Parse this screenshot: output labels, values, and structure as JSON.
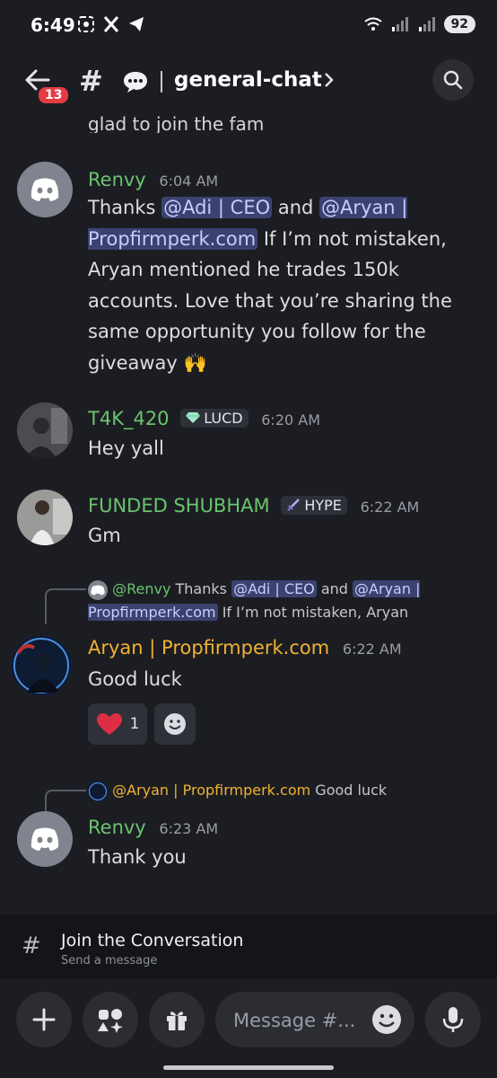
{
  "status": {
    "time": "6:49",
    "battery": "92"
  },
  "header": {
    "unread_count": "13",
    "channel_name": "general-chat"
  },
  "clipped_text": "glad to join the fam",
  "messages": [
    {
      "author": "Renvy",
      "time": "6:04 AM",
      "author_color": "#69c46e",
      "text_parts": {
        "a": "Thanks ",
        "m1": "@Adi | CEO",
        "b": " and ",
        "m2": "@Aryan | Propfirmperk.com",
        "c": "  If I’m not mistaken, Aryan mentioned he trades 150k accounts. Love that you’re sharing the same opportunity you follow for the giveaway 🙌"
      }
    },
    {
      "author": "T4K_420",
      "role_badge": "LUCD",
      "time": "6:20 AM",
      "author_color": "#69c46e",
      "text": "Hey yall"
    },
    {
      "author": "FUNDED SHUBHAM",
      "role_badge": "HYPE",
      "time": "6:22 AM",
      "author_color": "#69c46e",
      "text": "Gm"
    },
    {
      "reply": {
        "author": "@Renvy",
        "a": "Thanks ",
        "m1": "@Adi | CEO",
        "b": " and ",
        "m2": "@Aryan | Propfirmperk.com",
        "c": "  If I’m not mistaken, Aryan"
      },
      "author": "Aryan | Propfirmperk.com",
      "time": "6:22 AM",
      "author_color": "#f0b232",
      "text": "Good luck",
      "reactions": [
        {
          "emoji": "heart",
          "count": "1"
        },
        {
          "emoji": "add-reaction",
          "count": ""
        }
      ]
    },
    {
      "reply": {
        "author": "@Aryan | Propfirmperk.com",
        "text": "Good luck"
      },
      "author": "Renvy",
      "time": "6:23 AM",
      "author_color": "#69c46e",
      "text": "Thank you"
    }
  ],
  "join_banner": {
    "title": "Join the Conversation",
    "subtitle": "Send a message"
  },
  "composer": {
    "placeholder": "Message #..."
  },
  "colors": {
    "background": "#1c1d22",
    "mention_bg": "#3c4270",
    "green_name": "#69c46e",
    "gold_name": "#f0b232",
    "unread_badge": "#e63b44"
  }
}
